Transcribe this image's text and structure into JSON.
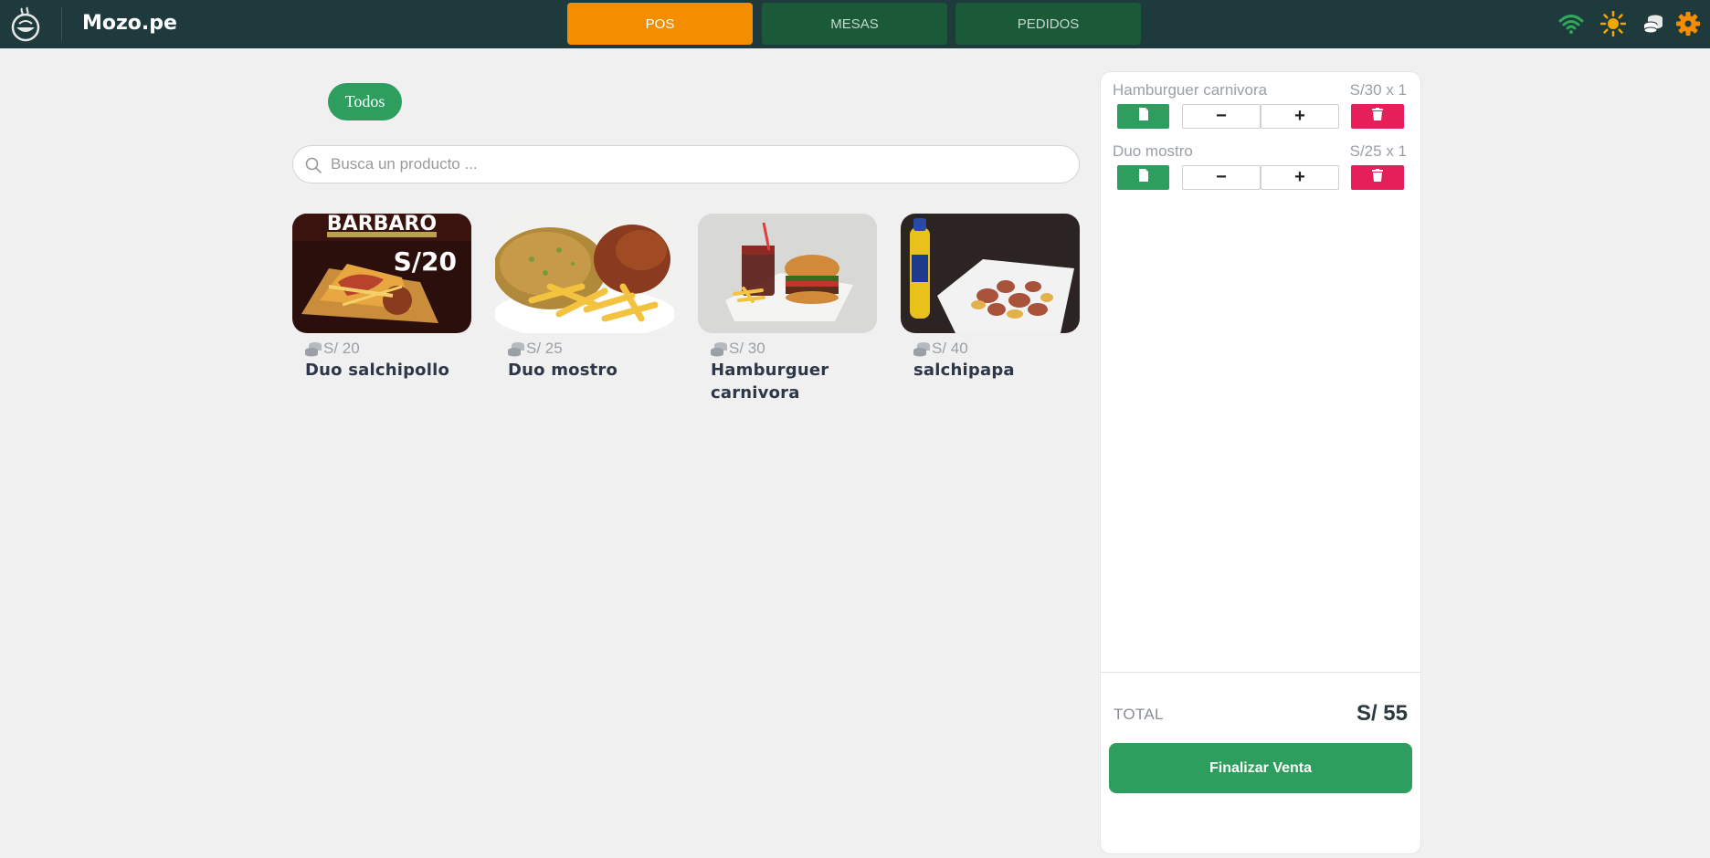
{
  "app": {
    "brand": "Mozo.pe"
  },
  "nav": {
    "tabs": [
      {
        "label": "POS",
        "active": true
      },
      {
        "label": "MESAS",
        "active": false
      },
      {
        "label": "PEDIDOS",
        "active": false
      }
    ]
  },
  "header_icons": [
    "wifi-icon",
    "sun-icon",
    "coins-icon",
    "gear-icon"
  ],
  "colors": {
    "topbar": "#1f3a3d",
    "active_tab": "#f58d00",
    "inactive_tab": "#1a5a38",
    "green": "#2e9e5e",
    "danger": "#e61e5a",
    "wifi": "#2fa858",
    "sun": "#f0a800",
    "gear": "#f58d00"
  },
  "filters": {
    "category": "Todos"
  },
  "search": {
    "placeholder": "Busca un producto ..."
  },
  "products": [
    {
      "price": "S/ 20",
      "name": "Duo salchipollo",
      "image_text": "BARBARO",
      "image_price": "S/20"
    },
    {
      "price": "S/ 25",
      "name": "Duo mostro"
    },
    {
      "price": "S/ 30",
      "name": "Hamburguer carnivora"
    },
    {
      "price": "S/ 40",
      "name": "salchipapa"
    }
  ],
  "cart": {
    "items": [
      {
        "name": "Hamburguer carnivora",
        "price": "S/30 x 1"
      },
      {
        "name": "Duo mostro",
        "price": "S/25 x 1"
      }
    ],
    "minus": "−",
    "plus": "+",
    "total_label": "TOTAL",
    "total_value": "S/ 55",
    "finish_label": "Finalizar Venta"
  }
}
